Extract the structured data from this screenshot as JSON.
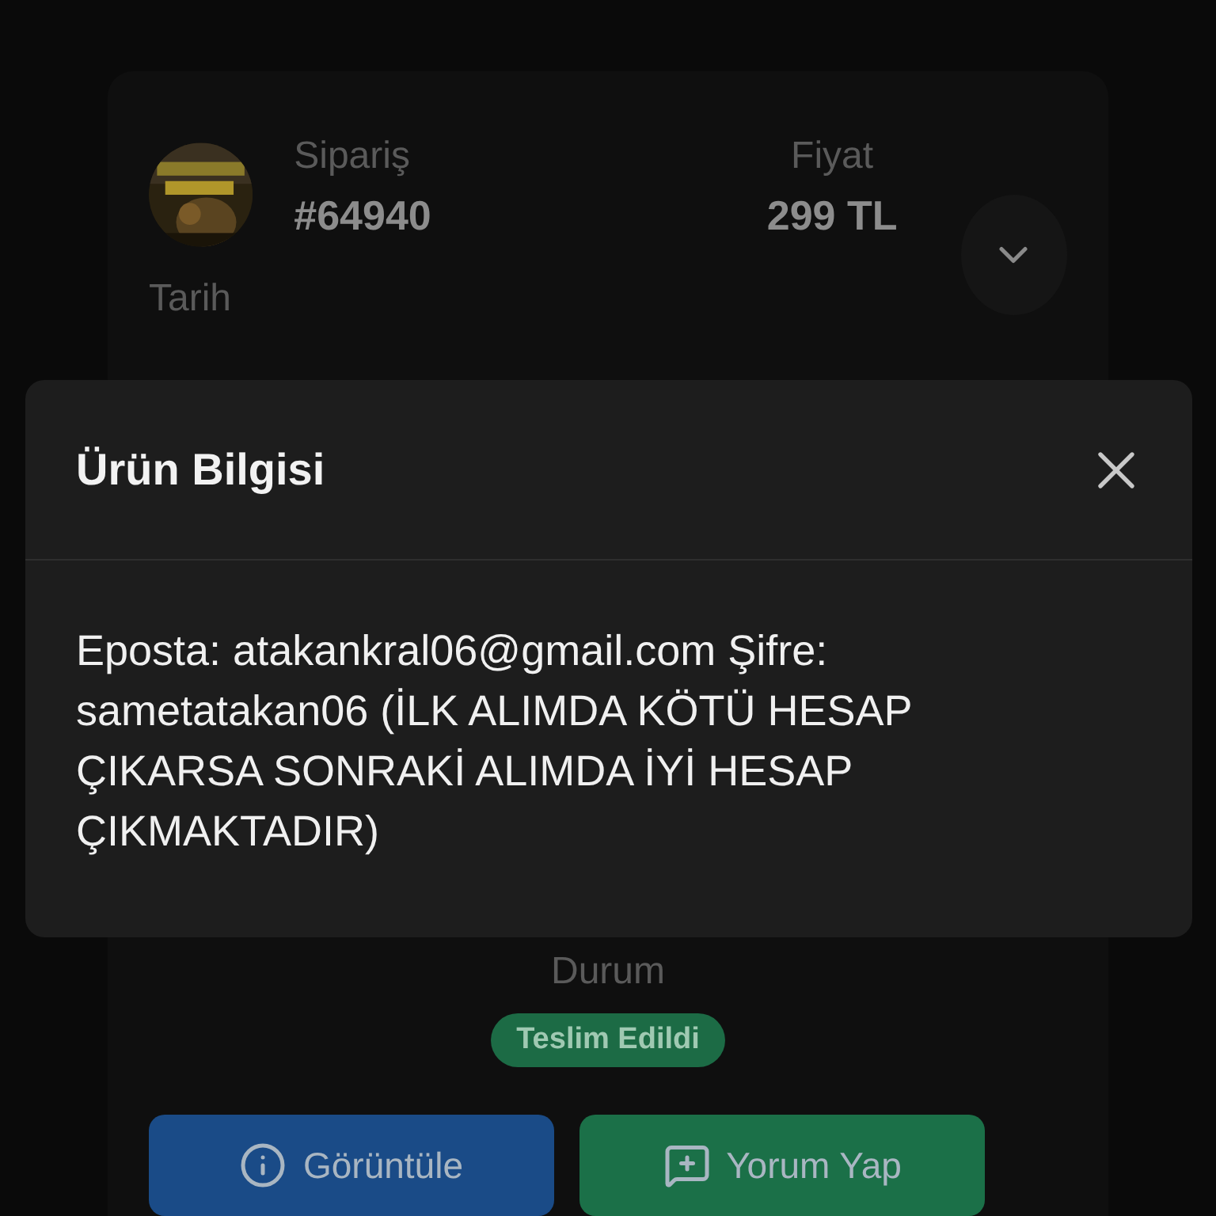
{
  "order": {
    "label": "Sipariş",
    "number": "#64940"
  },
  "price": {
    "label": "Fiyat",
    "value": "299 TL"
  },
  "date": {
    "label": "Tarih"
  },
  "status": {
    "label": "Durum",
    "badge": "Teslim Edildi"
  },
  "buttons": [
    {
      "label": "Görüntüle",
      "kind": "view"
    },
    {
      "label": "Yorum Yap",
      "kind": "comment"
    }
  ],
  "modal": {
    "title": "Ürün Bilgisi",
    "body": "Eposta: atakankral06@gmail.com Şifre: sametatakan06 (İLK ALIMDA KÖTÜ HESAP ÇIKARSA SONRAKİ ALIMDA İYİ HESAP ÇIKMAKTADIR)"
  }
}
